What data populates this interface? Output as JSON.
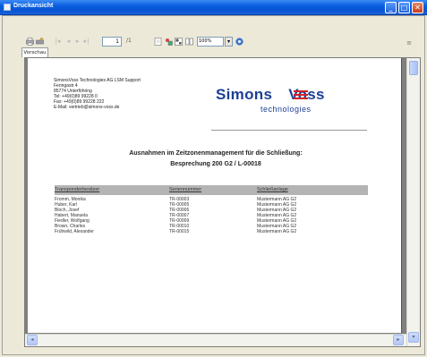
{
  "window": {
    "title": "Druckansicht",
    "buttons": {
      "minimize": "_",
      "maximize": "□",
      "close": "✕"
    }
  },
  "toolbar": {
    "nav_first": "|◂",
    "nav_prev": "◂",
    "nav_next": "▸",
    "nav_last": "▸|",
    "page_value": "1",
    "page_total": "/1",
    "zoom_value": "100%",
    "more_label": "≡"
  },
  "tab": {
    "label": "Vorschau"
  },
  "report": {
    "address": [
      "SimonsVoss Technologies AG LSM Support",
      "Feringastr 4",
      "85774 Unterföhring",
      "Tel: +49(0)89 99228 0",
      "Fax: +49(0)89 99228 222",
      "E-Mail: vertrieb@simons-voss.de"
    ],
    "logo": {
      "main": "Simons Voss",
      "sub": "technologies",
      "color": "#1c3f94",
      "accent": "#d0202b"
    },
    "heading1": "Ausnahmen im Zeitzonenmanagement für die Schließung:",
    "heading2": "Besprechung 200 G2 / L-00018",
    "columns": [
      "Transponderbesitzer",
      "Seriennummer",
      "Schließanlage"
    ],
    "rows": [
      [
        "Fromm, Monika",
        "TR-00003",
        "Mustermann AG G2"
      ],
      [
        "Huber, Karl",
        "TR-00005",
        "Mustermann AG G2"
      ],
      [
        "Bloch, Josef",
        "TR-00006",
        "Mustermann AG G2"
      ],
      [
        "Habert, Manuela",
        "TR-00007",
        "Mustermann AG G2"
      ],
      [
        "Fiedler, Wolfgang",
        "TR-00009",
        "Mustermann AG G2"
      ],
      [
        "Brown, Charles",
        "TR-00010",
        "Mustermann AG G2"
      ],
      [
        "Frühwild, Alexander",
        "TR-00015",
        "Mustermann AG G2"
      ]
    ]
  }
}
